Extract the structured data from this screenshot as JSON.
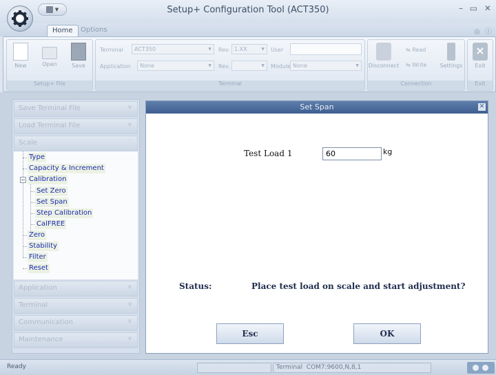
{
  "window": {
    "title": "Setup+ Configuration Tool (ACT350)",
    "controls": "– ▭ ✕"
  },
  "tabs": [
    {
      "label": "Home",
      "active": true
    },
    {
      "label": "Options",
      "active": false
    }
  ],
  "help_icons": "◎ ⓘ",
  "ribbon": {
    "file_group": {
      "label": "Setup+ File",
      "buttons": [
        {
          "label": "New",
          "icon": "new-doc-icon"
        },
        {
          "label": "Open",
          "icon": "folder-icon"
        },
        {
          "label": "Save",
          "icon": "floppy-icon"
        }
      ]
    },
    "terminal_group": {
      "label": "Terminal",
      "terminal_label": "Terminal",
      "terminal_value": "ACT350",
      "rev_label": "Rev.",
      "rev_value": "1.XX",
      "user_label": "User",
      "application_label": "Application",
      "application_value": "None",
      "rev2_label": "Rev.",
      "module_label": "Module",
      "module_value": "None"
    },
    "connection_group": {
      "label": "Connection",
      "disconnect": "Disconnect",
      "read": "Read",
      "write": "Write",
      "settings": "Settings"
    },
    "exit_group": {
      "label": "Exit",
      "exit": "Exit"
    }
  },
  "nav": {
    "sections_top": [
      "Save Terminal File",
      "Load Terminal File",
      "Scale"
    ],
    "tree": {
      "type": "Type",
      "capacity": "Capacity & Increment",
      "calibration": "Calibration",
      "set_zero": "Set Zero",
      "set_span": "Set Span",
      "step_calibration": "Step Calibration",
      "calfree": "CalFREE",
      "zero": "Zero",
      "stability": "Stability",
      "filter": "Filter",
      "reset": "Reset"
    },
    "sections_bottom": [
      "Application",
      "Terminal",
      "Communication",
      "Maintenance"
    ]
  },
  "dialog": {
    "title": "Set Span",
    "test_load_label": "Test Load 1",
    "test_load_value": "60",
    "unit": "kg",
    "status_label": "Status:",
    "status_message": "Place test load on scale and start adjustment?",
    "esc_label": "Esc",
    "ok_label": "OK"
  },
  "statusbar": {
    "ready": "Ready",
    "terminal_label": "Terminal",
    "port": "COM7:9600,N,8,1"
  },
  "colors": {
    "tree_link": "#1b2bb0",
    "dialog_title": "#3d5f90",
    "status_text": "#1f2c4c"
  }
}
